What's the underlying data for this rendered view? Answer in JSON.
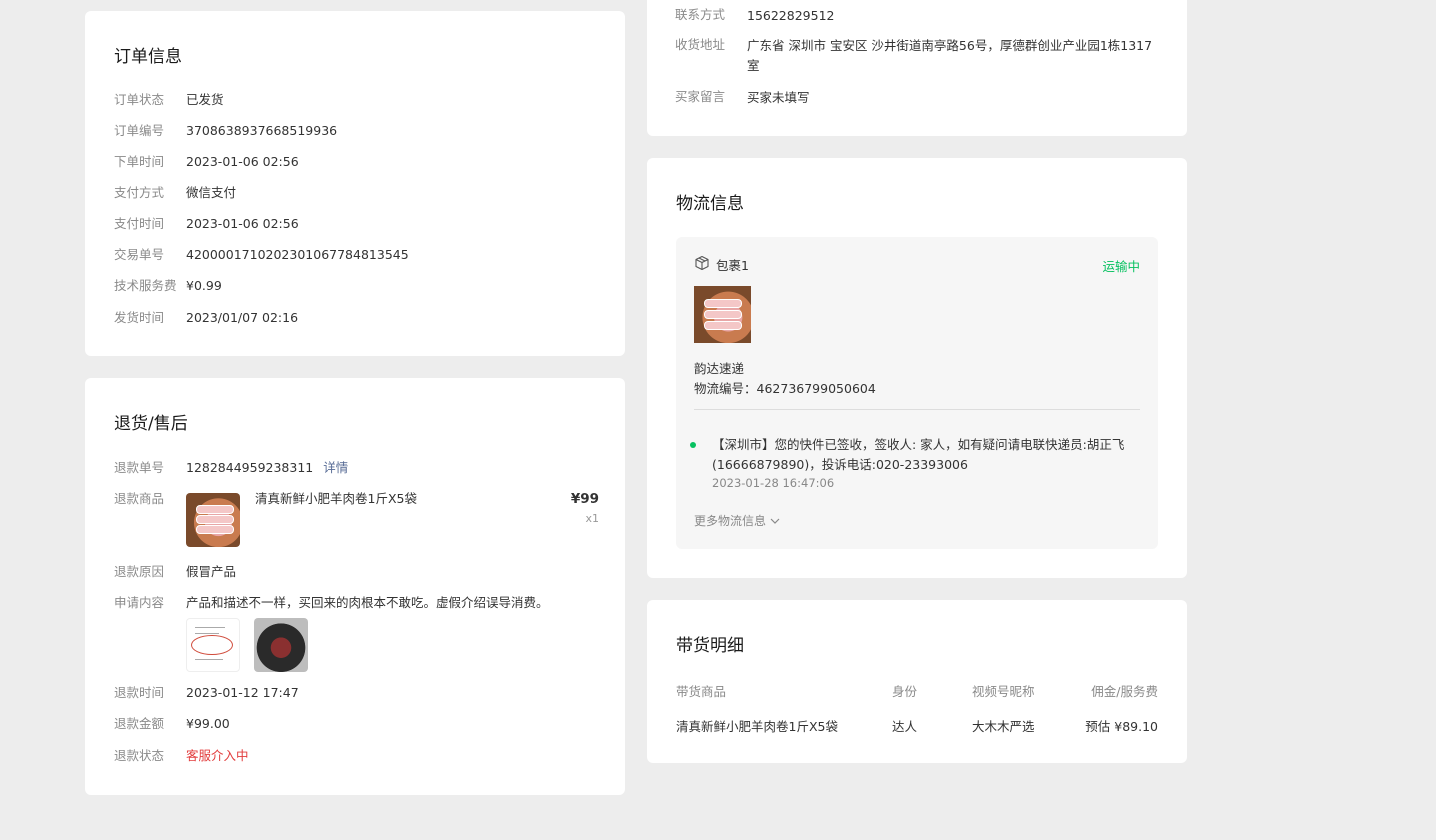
{
  "order_info": {
    "title": "订单信息",
    "rows": [
      {
        "label": "订单状态",
        "value": "已发货"
      },
      {
        "label": "订单编号",
        "value": "3708638937668519936"
      },
      {
        "label": "下单时间",
        "value": "2023-01-06 02:56"
      },
      {
        "label": "支付方式",
        "value": "微信支付"
      },
      {
        "label": "支付时间",
        "value": "2023-01-06 02:56"
      },
      {
        "label": "交易单号",
        "value": "4200001710202301067784813545"
      },
      {
        "label": "技术服务费",
        "value": "¥0.99"
      },
      {
        "label": "发货时间",
        "value": "2023/01/07 02:16"
      }
    ]
  },
  "refund": {
    "title": "退货/售后",
    "refund_no_label": "退款单号",
    "refund_no": "1282844959238311",
    "detail_link": "详情",
    "product_label": "退款商品",
    "product_title": "清真新鲜小肥羊肉卷1斤X5袋",
    "product_price": "¥99",
    "product_qty": "x1",
    "reason_label": "退款原因",
    "reason": "假冒产品",
    "content_label": "申请内容",
    "content": "产品和描述不一样，买回来的肉根本不敢吃。虚假介绍误导消费。",
    "time_label": "退款时间",
    "time": "2023-01-12 17:47",
    "amount_label": "退款金额",
    "amount": "¥99.00",
    "status_label": "退款状态",
    "status": "客服介入中",
    "status_color": "#e23c3c"
  },
  "buyer": {
    "contact_label": "联系方式",
    "contact": "15622829512",
    "address_label": "收货地址",
    "address": "广东省  深圳市  宝安区  沙井街道南亭路56号，厚德群创业产业园1栋1317室",
    "message_label": "买家留言",
    "message": "买家未填写"
  },
  "logistics": {
    "title": "物流信息",
    "package_name": "包裹1",
    "package_icon": "package-icon",
    "status": "运输中",
    "status_color": "#07c160",
    "courier": "韵达速递",
    "tracking_label": "物流编号：",
    "tracking_no": "462736799050604",
    "latest_text": "【深圳市】您的快件已签收，签收人: 家人，如有疑问请电联快递员:胡正飞(16666879890)，投诉电话:020-23393006",
    "latest_time": "2023-01-28 16:47:06",
    "more": "更多物流信息"
  },
  "commission": {
    "title": "带货明细",
    "headers": [
      "带货商品",
      "身份",
      "视频号昵称",
      "佣金/服务费"
    ],
    "row": [
      "清真新鲜小肥羊肉卷1斤X5袋",
      "达人",
      "大木木严选",
      "预估 ¥89.10"
    ]
  }
}
